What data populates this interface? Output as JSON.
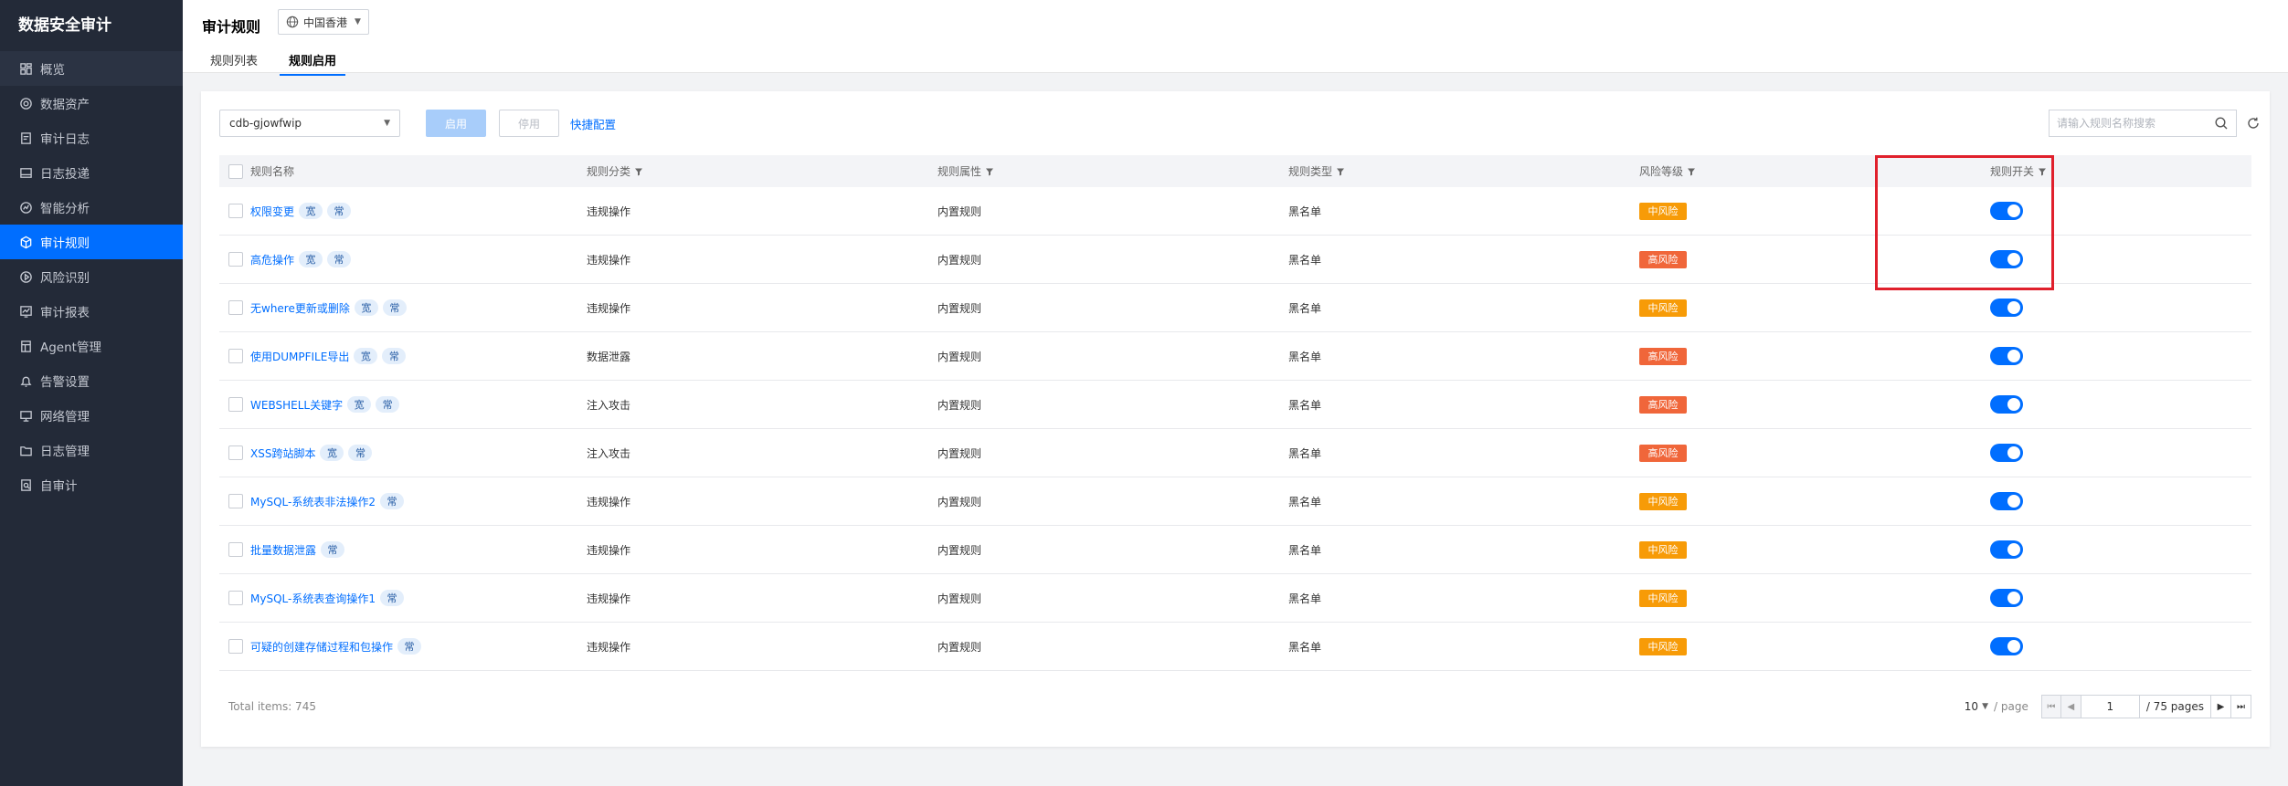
{
  "app": {
    "title": "数据安全审计"
  },
  "sidebar": {
    "items": [
      {
        "label": "概览",
        "icon": "dashboard-icon"
      },
      {
        "label": "数据资产",
        "icon": "asset-icon"
      },
      {
        "label": "审计日志",
        "icon": "log-icon"
      },
      {
        "label": "日志投递",
        "icon": "delivery-icon"
      },
      {
        "label": "智能分析",
        "icon": "analysis-icon"
      },
      {
        "label": "审计规则",
        "icon": "rule-icon",
        "active": true
      },
      {
        "label": "风险识别",
        "icon": "risk-icon"
      },
      {
        "label": "审计报表",
        "icon": "report-icon"
      },
      {
        "label": "Agent管理",
        "icon": "agent-icon"
      },
      {
        "label": "告警设置",
        "icon": "alert-icon"
      },
      {
        "label": "网络管理",
        "icon": "network-icon"
      },
      {
        "label": "日志管理",
        "icon": "folder-icon"
      },
      {
        "label": "自审计",
        "icon": "self-audit-icon"
      }
    ]
  },
  "header": {
    "title": "审计规则",
    "region": "中国香港",
    "tabs": [
      {
        "label": "规则列表"
      },
      {
        "label": "规则启用",
        "active": true
      }
    ]
  },
  "toolbar": {
    "instance": "cdb-gjowfwip",
    "enable_label": "启用",
    "disable_label": "停用",
    "quick_config_label": "快捷配置",
    "search_placeholder": "请输入规则名称搜索"
  },
  "table": {
    "columns": [
      "规则名称",
      "规则分类",
      "规则属性",
      "规则类型",
      "风险等级",
      "规则开关"
    ],
    "rows": [
      {
        "name": "权限变更",
        "tags": [
          "宽",
          "常"
        ],
        "category": "违规操作",
        "attribute": "内置规则",
        "type": "黑名单",
        "risk": "中风险",
        "enabled": true
      },
      {
        "name": "高危操作",
        "tags": [
          "宽",
          "常"
        ],
        "category": "违规操作",
        "attribute": "内置规则",
        "type": "黑名单",
        "risk": "高风险",
        "enabled": true
      },
      {
        "name": "无where更新或删除",
        "tags": [
          "宽",
          "常"
        ],
        "category": "违规操作",
        "attribute": "内置规则",
        "type": "黑名单",
        "risk": "中风险",
        "enabled": true
      },
      {
        "name": "使用DUMPFILE导出",
        "tags": [
          "宽",
          "常"
        ],
        "category": "数据泄露",
        "attribute": "内置规则",
        "type": "黑名单",
        "risk": "高风险",
        "enabled": true
      },
      {
        "name": "WEBSHELL关键字",
        "tags": [
          "宽",
          "常"
        ],
        "category": "注入攻击",
        "attribute": "内置规则",
        "type": "黑名单",
        "risk": "高风险",
        "enabled": true
      },
      {
        "name": "XSS跨站脚本",
        "tags": [
          "宽",
          "常"
        ],
        "category": "注入攻击",
        "attribute": "内置规则",
        "type": "黑名单",
        "risk": "高风险",
        "enabled": true
      },
      {
        "name": "MySQL-系统表非法操作2",
        "tags": [
          "常"
        ],
        "category": "违规操作",
        "attribute": "内置规则",
        "type": "黑名单",
        "risk": "中风险",
        "enabled": true
      },
      {
        "name": "批量数据泄露",
        "tags": [
          "常"
        ],
        "category": "违规操作",
        "attribute": "内置规则",
        "type": "黑名单",
        "risk": "中风险",
        "enabled": true
      },
      {
        "name": "MySQL-系统表查询操作1",
        "tags": [
          "常"
        ],
        "category": "违规操作",
        "attribute": "内置规则",
        "type": "黑名单",
        "risk": "中风险",
        "enabled": true
      },
      {
        "name": "可疑的创建存储过程和包操作",
        "tags": [
          "常"
        ],
        "category": "违规操作",
        "attribute": "内置规则",
        "type": "黑名单",
        "risk": "中风险",
        "enabled": true
      }
    ]
  },
  "pagination": {
    "total": "Total items: 745",
    "page_size": "10",
    "per_page": "/ page",
    "current": "1",
    "total_pages": "/ 75 pages"
  },
  "colors": {
    "accent": "#006eff",
    "medium_risk": "#f79b07",
    "high_risk": "#f0663a",
    "sidebar_bg": "#232a38",
    "highlight": "#e0202c"
  }
}
